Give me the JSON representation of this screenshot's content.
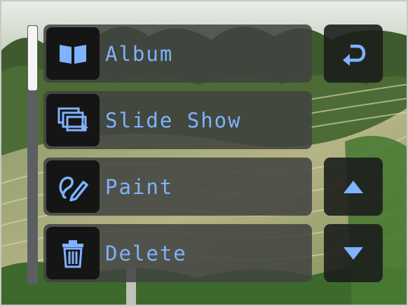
{
  "menu": {
    "items": [
      {
        "label": "Album",
        "icon": "book-icon"
      },
      {
        "label": "Slide Show",
        "icon": "slideshow-icon"
      },
      {
        "label": "Paint",
        "icon": "paint-icon"
      },
      {
        "label": "Delete",
        "icon": "trash-icon"
      }
    ]
  },
  "side_buttons": {
    "back_icon": "return-arrow-icon",
    "up_icon": "arrow-up-icon",
    "down_icon": "arrow-down-icon"
  },
  "colors": {
    "label": "#7fb2ff",
    "icon": "#7fb2ff",
    "panel": "#404240",
    "icon_tile": "#141514"
  },
  "scroll": {
    "position": 0.0,
    "visible_fraction": 0.25
  }
}
